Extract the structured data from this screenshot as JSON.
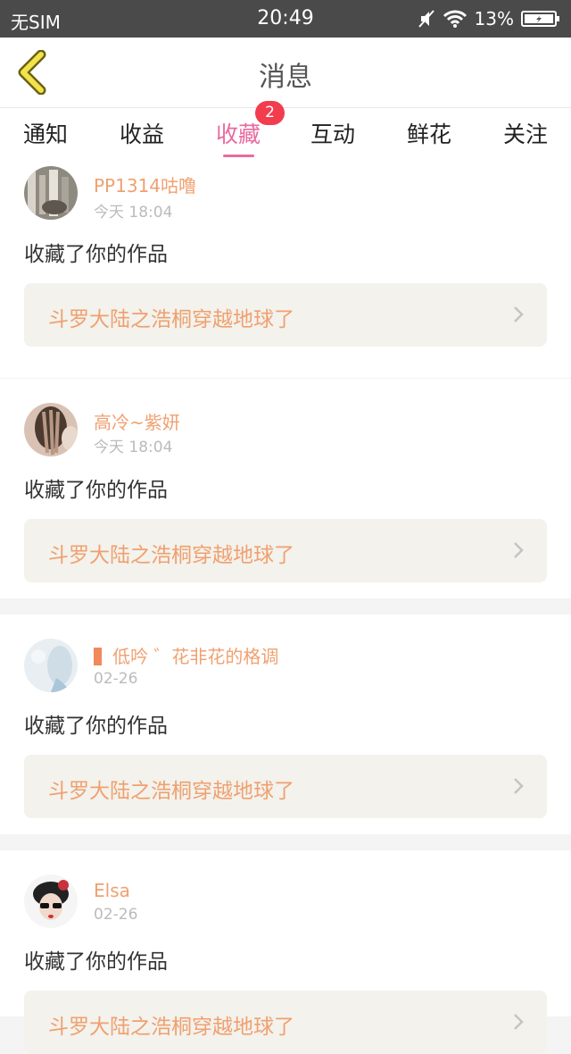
{
  "status_bar": {
    "carrier": "无SIM",
    "time": "20:49",
    "battery": "13%",
    "icons": [
      "mute-icon",
      "wifi-icon",
      "battery-icon"
    ]
  },
  "header": {
    "title": "消息",
    "back_icon": "chevron-left-icon"
  },
  "tabs": [
    {
      "label": "通知"
    },
    {
      "label": "收益"
    },
    {
      "label": "收藏",
      "active": true,
      "badge": "2"
    },
    {
      "label": "互动"
    },
    {
      "label": "鲜花"
    },
    {
      "label": "关注"
    }
  ],
  "colors": {
    "accent_pink": "#e86aa0",
    "badge_red": "#f23d4f",
    "name_orange": "#f0a070",
    "link_bg": "#f3f2ec",
    "status_bar_bg": "#4a4a4a"
  },
  "messages": [
    {
      "user": "PP1314咕噜",
      "time": "今天 18:04",
      "action": "收藏了你的作品",
      "work": "斗罗大陆之浩桐穿越地球了"
    },
    {
      "user": "高冷~紫妍",
      "time": "今天 18:04",
      "action": "收藏了你的作品",
      "work": "斗罗大陆之浩桐穿越地球了"
    },
    {
      "user": "低吟 ゛花非花的格调",
      "time": "02-26",
      "action": "收藏了你的作品",
      "work": "斗罗大陆之浩桐穿越地球了"
    },
    {
      "user": "Elsa",
      "time": "02-26",
      "action": "收藏了你的作品",
      "work": "斗罗大陆之浩桐穿越地球了"
    }
  ]
}
